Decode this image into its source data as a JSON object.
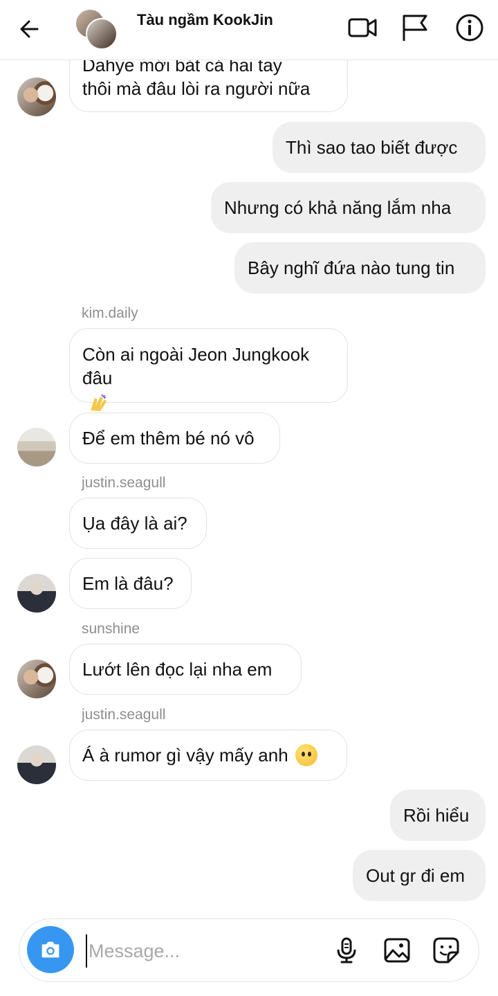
{
  "header": {
    "title": "Tàu ngầm KookJin",
    "icons": [
      "back-arrow-icon",
      "video-call-icon",
      "flag-icon",
      "info-icon"
    ]
  },
  "messages": [
    {
      "type": "in",
      "lines": [
        "Dahye mới bắt cả hai tay",
        "thôi mà đâu lòi ra người nữa"
      ]
    },
    {
      "type": "out",
      "text": "Thì sao tao biết được"
    },
    {
      "type": "out",
      "text": "Nhưng có khả năng lắm nha"
    },
    {
      "type": "out",
      "text": "Bây nghĩ đứa nào tung tin"
    },
    {
      "type": "sender",
      "text": "kim.daily"
    },
    {
      "type": "in",
      "lines": [
        "Còn ai ngoài Jeon Jungkook",
        "đâu"
      ],
      "emoji": "waving-hands-emoji"
    },
    {
      "type": "in",
      "text": "Để em thêm bé nó vô"
    },
    {
      "type": "sender",
      "text": "justin.seagull"
    },
    {
      "type": "in",
      "text": "Ụa đây là ai?"
    },
    {
      "type": "in",
      "text": "Em là đâu?"
    },
    {
      "type": "sender",
      "text": "sunshine"
    },
    {
      "type": "in",
      "text": "Lướt lên đọc lại nha em"
    },
    {
      "type": "sender",
      "text": "justin.seagull"
    },
    {
      "type": "in",
      "text": "Á à rumor gì vậy mấy anh",
      "emoji": "hushed-face-emoji"
    },
    {
      "type": "out",
      "text": "Rồi hiểu"
    },
    {
      "type": "out",
      "text": "Out gr đi em"
    }
  ],
  "composer": {
    "placeholder": "Message...",
    "value": "",
    "icons": [
      "camera-icon",
      "microphone-icon",
      "gallery-icon",
      "sticker-icon"
    ],
    "camera_color": "#3797f0"
  },
  "colors": {
    "incoming_bubble": "#ffffff",
    "outgoing_bubble": "#efefef",
    "sender_text": "#8e8e8e"
  }
}
